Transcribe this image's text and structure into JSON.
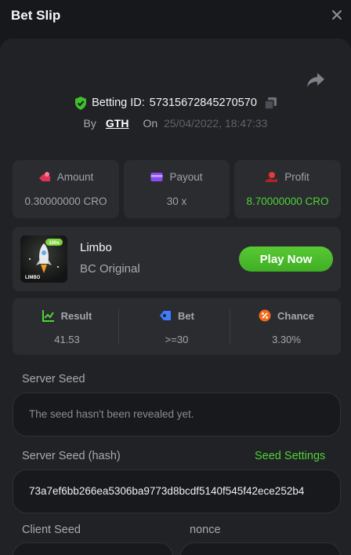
{
  "header": {
    "title": "Bet Slip",
    "close_icon": "close-icon"
  },
  "bet": {
    "id_label": "Betting ID:",
    "id_value": "57315672845270570",
    "by_label": "By",
    "user": "GTH",
    "on_label": "On",
    "datetime": "25/04/2022, 18:47:33"
  },
  "stats": {
    "amount_label": "Amount",
    "amount_value": "0.30000000 CRO",
    "payout_label": "Payout",
    "payout_value": "30 x",
    "profit_label": "Profit",
    "profit_value": "8.70000000 CRO"
  },
  "game": {
    "name": "Limbo",
    "subtitle": "BC Original",
    "thumb_text": "LIMBO",
    "thumb_badge": "100x",
    "play_label": "Play Now"
  },
  "result": {
    "result_label": "Result",
    "result_value": "41.53",
    "bet_label": "Bet",
    "bet_value": ">=30",
    "chance_label": "Chance",
    "chance_value": "3.30%"
  },
  "seeds": {
    "server_seed_label": "Server Seed",
    "server_seed_value": "The seed hasn't been revealed yet.",
    "server_hash_label": "Server Seed (hash)",
    "seed_settings_link": "Seed Settings",
    "server_hash_value": "73a7ef6bb266ea5306ba9773d8bcdf5140f545f42ece252b4",
    "client_seed_label": "Client Seed",
    "nonce_label": "nonce"
  },
  "colors": {
    "accent_green": "#4fd336",
    "panel_bg": "#202225",
    "card_bg": "#2a2c30",
    "input_bg": "#18191c",
    "amount_icon": "#e0325b",
    "payout_icon": "#8a4cf0",
    "profit_icon": "#e23a3a",
    "result_icon": "#4fd336",
    "bet_icon": "#3e7bff",
    "chance_icon": "#f26b1d"
  }
}
